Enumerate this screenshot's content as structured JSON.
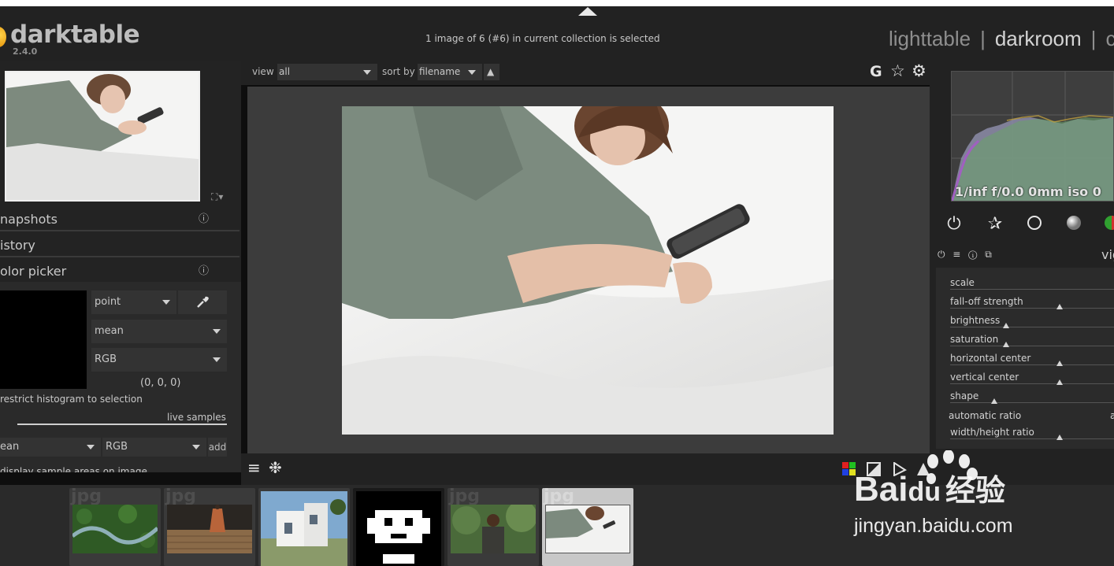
{
  "app": {
    "name": "darktable",
    "version": "2.4.0"
  },
  "header": {
    "status": "1 image of 6 (#6) in current collection is selected",
    "views": [
      {
        "label": "lighttable",
        "active": false
      },
      {
        "label": "darkroom",
        "active": true
      },
      {
        "label": "c",
        "active": false
      }
    ],
    "separator": "|"
  },
  "left_panel": {
    "expand_icons": "⛶▾",
    "sections": [
      {
        "label": "napshots",
        "info_icon": "ⓘ"
      },
      {
        "label": "istory",
        "info_icon": ""
      },
      {
        "label": "olor picker",
        "info_icon": "ⓘ"
      }
    ],
    "color_picker": {
      "mode": "point",
      "statistic": "mean",
      "colorspace": "RGB",
      "values": "(0, 0, 0)",
      "restrict_label": "restrict histogram to selection",
      "live_samples_label": "live samples",
      "sample_statistic": "ean",
      "sample_colorspace": "RGB",
      "add_label": "add",
      "display_label": "display sample areas on image"
    }
  },
  "center": {
    "view_label": "view",
    "view_value": "all",
    "sort_label": "sort by",
    "sort_value": "filename",
    "sort_dir": "▲",
    "top_icons": {
      "g": "G",
      "star": "☆",
      "gear": "⚙"
    },
    "bottom_left_icons": {
      "menu": "≡",
      "styles": "❉"
    }
  },
  "right_panel": {
    "histogram_info": "1/inf f/0.0 0mm iso 0",
    "module_name": "vig",
    "module_header_icons": "⏻ ≡ ⓘ ⧉",
    "sliders": [
      {
        "label": "scale",
        "value": null
      },
      {
        "label": "fall-off strength",
        "value": 0.67
      },
      {
        "label": "brightness",
        "value": 0.34
      },
      {
        "label": "saturation",
        "value": 0.34
      },
      {
        "label": "horizontal center",
        "value": 0.67
      },
      {
        "label": "vertical center",
        "value": 0.67
      },
      {
        "label": "shape",
        "value": 0.27
      },
      {
        "label": "automatic ratio",
        "value": null
      },
      {
        "label": "width/height ratio",
        "value": 0.67
      }
    ],
    "auto_ratio_flag": "a"
  },
  "filmstrip": {
    "items": [
      {
        "ext": "jpg",
        "desc": "river-aerial"
      },
      {
        "ext": "jpg",
        "desc": "hallway-floor"
      },
      {
        "ext": "",
        "desc": "white-house"
      },
      {
        "ext": "",
        "desc": "pixel-icon"
      },
      {
        "ext": "jpg",
        "desc": "woman-standing"
      },
      {
        "ext": "jpg",
        "desc": "woman-on-bed",
        "selected": true
      }
    ]
  },
  "watermark": {
    "brand": "Bai",
    "brand2": "du",
    "cn": "经验",
    "url": "jingyan.baidu.com"
  },
  "colors": {
    "bg": "#222222",
    "accent_logo": "#f0a000",
    "text": "#bcbcbc"
  }
}
